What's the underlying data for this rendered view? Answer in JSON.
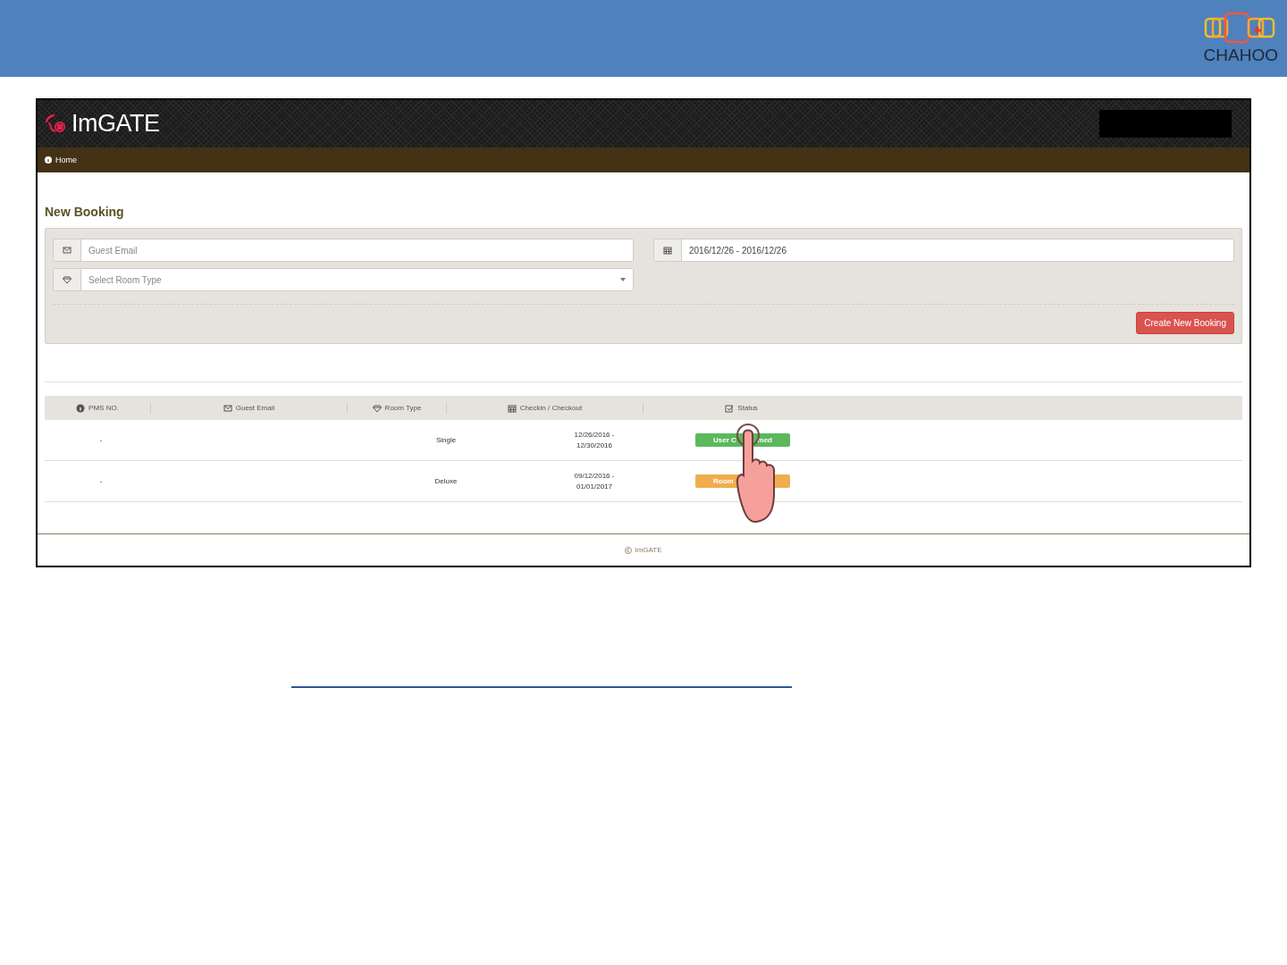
{
  "slide": {
    "logo_text": "CHAHOO"
  },
  "app": {
    "brand": "ImGATE",
    "breadcrumb": "Home",
    "page_title": "New Booking",
    "form": {
      "email": {
        "placeholder": "Guest Email"
      },
      "room_type": {
        "placeholder": "Select Room Type"
      },
      "dates": {
        "value": "2016/12/26 - 2016/12/26"
      },
      "submit": "Create New Booking"
    },
    "table": {
      "columns": [
        "PMS NO.",
        "Guest Email",
        "Room Type",
        "Checkin / Checkout",
        "Status"
      ],
      "rows": [
        {
          "pms_no": "-",
          "room_type": "Single",
          "dates": "12/26/2016 - 12/30/2016",
          "status": {
            "label_start": "User C",
            "label_end": "med",
            "kind": "confirmed"
          }
        },
        {
          "pms_no": "-",
          "room_type": "Deluxe",
          "dates": "09/12/2016 - 01/01/2017",
          "status": {
            "label_start": "Room",
            "kind": "pending"
          }
        }
      ]
    },
    "footer": "ImGATE"
  }
}
